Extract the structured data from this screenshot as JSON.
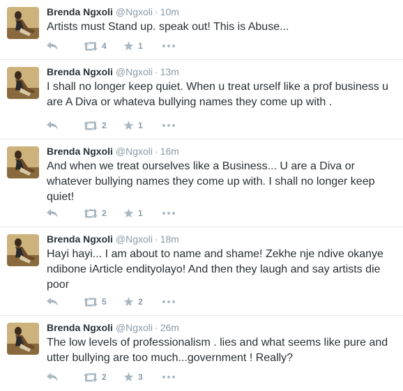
{
  "tweets": [
    {
      "fullname": "Brenda Ngxoli",
      "username": "@Ngxoli",
      "time": "10m",
      "text": "Artists must Stand up. speak out! This is Abuse...",
      "retweets": "4",
      "favorites": "1"
    },
    {
      "fullname": "Brenda Ngxoli",
      "username": "@Ngxoli",
      "time": "13m",
      "text": "I shall no longer keep quiet. When u treat urself like a prof business u are A Diva or whateva bullying names they come up with .",
      "retweets": "2",
      "favorites": "1"
    },
    {
      "fullname": "Brenda Ngxoli",
      "username": "@Ngxoli",
      "time": "16m",
      "text": "And when we treat ourselves like a Business... U are a Diva or whatever bullying names they come up with. I shall no longer keep quiet!",
      "retweets": "2",
      "favorites": "1"
    },
    {
      "fullname": "Brenda Ngxoli",
      "username": "@Ngxoli",
      "time": "18m",
      "text": "Hayi hayi... I am about to name and shame! Zekhe nje ndive okanye ndibone iArticle endityolayo! And then they laugh and say artists die poor",
      "retweets": "5",
      "favorites": "2"
    },
    {
      "fullname": "Brenda Ngxoli",
      "username": "@Ngxoli",
      "time": "26m",
      "text": "The low levels of  professionalism . lies and what seems like pure and utter bullying are too much...government ! Really?",
      "retweets": "2",
      "favorites": "3"
    }
  ],
  "separator": "·",
  "icons": {
    "reply": "reply-icon",
    "retweet": "retweet-icon",
    "favorite": "star-icon",
    "more": "more-dots-icon"
  },
  "colors": {
    "text": "#292f33",
    "meta": "#8899a6",
    "icon": "#aab8c2",
    "divider": "#e1e8ed"
  }
}
